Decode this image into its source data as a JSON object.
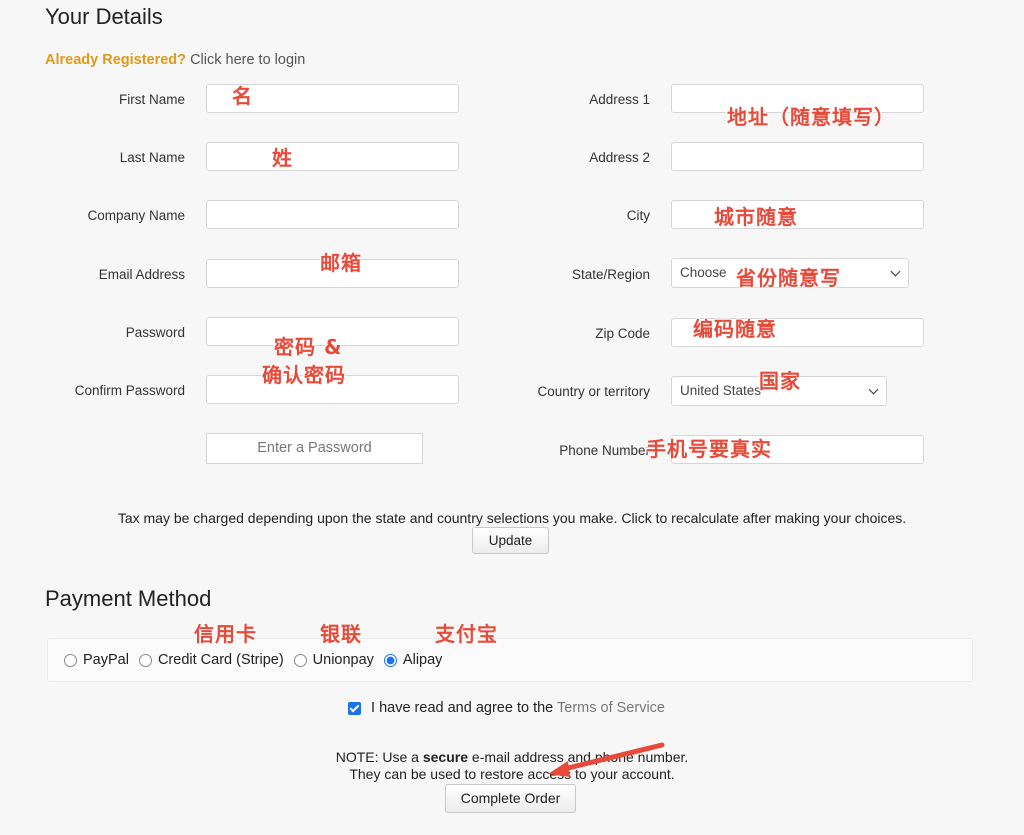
{
  "details_title": "Your Details",
  "login": {
    "strong": "Already Registered?",
    "link": "Click here to login"
  },
  "left_fields": {
    "first_name": "First Name",
    "last_name": "Last Name",
    "company_name": "Company Name",
    "email_address": "Email Address",
    "password": "Password",
    "confirm_password": "Confirm Password"
  },
  "password_hint": "Enter a Password",
  "right_fields": {
    "address1": "Address 1",
    "address2": "Address 2",
    "city": "City",
    "state": "State/Region",
    "zip": "Zip Code",
    "country": "Country or territory",
    "phone": "Phone Number"
  },
  "state_select_value": "Choose",
  "country_select_value": "United States",
  "tax_note": "Tax may be charged depending upon the state and country selections you make. Click to recalculate after making your choices.",
  "update_button": "Update",
  "payment_title": "Payment Method",
  "payment_options": [
    {
      "label": "PayPal",
      "checked": false
    },
    {
      "label": "Credit Card (Stripe)",
      "checked": false
    },
    {
      "label": "Unionpay",
      "checked": false
    },
    {
      "label": "Alipay",
      "checked": true
    }
  ],
  "terms": {
    "text": "I have read and agree to the",
    "link": "Terms of Service",
    "checked": true
  },
  "note": {
    "prefix": "NOTE: Use a",
    "strong": "secure",
    "suffix": "e-mail address and phone number.",
    "line2": "They can be used to restore access to your account."
  },
  "complete_button": "Complete Order",
  "annotations": {
    "first_name": "名",
    "last_name": "姓",
    "email": "邮箱",
    "password_1": "密码 &",
    "password_2": "确认密码",
    "address": "地址（随意填写）",
    "city": "城市随意",
    "state": "省份随意写",
    "zip": "编码随意",
    "country": "国家",
    "phone": "手机号要真实",
    "credit_card": "信用卡",
    "unionpay": "银联",
    "alipay": "支付宝"
  },
  "annotation_color": "#e84a3a",
  "accent_color": "#e09a1c",
  "check_color": "#1a73e8"
}
